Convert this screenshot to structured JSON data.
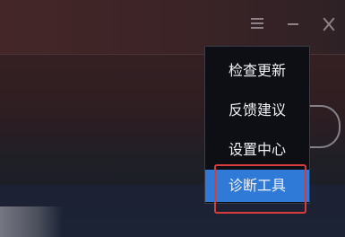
{
  "window": {
    "controls": {
      "menu_icon": "hamburger-icon",
      "minimize_icon": "minimize-icon",
      "close_icon": "close-icon"
    }
  },
  "menu": {
    "items": [
      {
        "label": "检查更新"
      },
      {
        "label": "反馈建议"
      },
      {
        "label": "设置中心"
      },
      {
        "label": "诊断工具"
      }
    ],
    "selected_index": 3
  },
  "colors": {
    "selected_background": "#2f79d7",
    "highlight_border": "#d73c3c"
  }
}
